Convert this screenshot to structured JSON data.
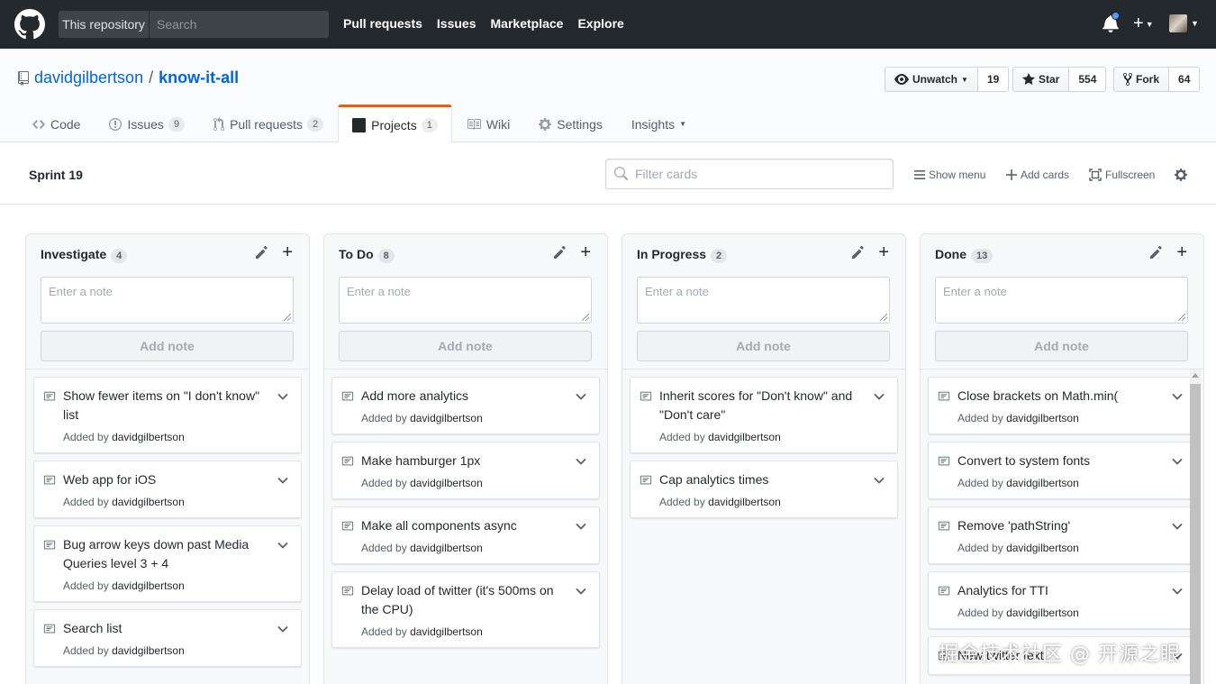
{
  "topbar": {
    "scope_label": "This repository",
    "search_placeholder": "Search",
    "nav": [
      "Pull requests",
      "Issues",
      "Marketplace",
      "Explore"
    ],
    "plus_label": "+"
  },
  "repo": {
    "owner": "davidgilbertson",
    "separator": "/",
    "name": "know-it-all",
    "actions": {
      "watch_label": "Unwatch",
      "watch_count": "19",
      "star_label": "Star",
      "star_count": "554",
      "fork_label": "Fork",
      "fork_count": "64"
    },
    "nav": [
      {
        "label": "Code",
        "count": ""
      },
      {
        "label": "Issues",
        "count": "9"
      },
      {
        "label": "Pull requests",
        "count": "2"
      },
      {
        "label": "Projects",
        "count": "1"
      },
      {
        "label": "Wiki",
        "count": ""
      },
      {
        "label": "Settings",
        "count": ""
      },
      {
        "label": "Insights",
        "count": ""
      }
    ]
  },
  "project": {
    "title": "Sprint 19",
    "filter_placeholder": "Filter cards",
    "show_menu": "Show menu",
    "add_cards": "Add cards",
    "fullscreen": "Fullscreen"
  },
  "note_form": {
    "placeholder": "Enter a note",
    "button": "Add note"
  },
  "meta_prefix": "Added by",
  "columns": [
    {
      "name": "Investigate",
      "count": "4",
      "cards": [
        {
          "title": "Show fewer items on \"I don't know\" list",
          "author": "davidgilbertson"
        },
        {
          "title": "Web app for iOS",
          "author": "davidgilbertson"
        },
        {
          "title": "Bug arrow keys down past Media Queries level 3 + 4",
          "author": "davidgilbertson"
        },
        {
          "title": "Search list",
          "author": "davidgilbertson"
        }
      ]
    },
    {
      "name": "To Do",
      "count": "8",
      "cards": [
        {
          "title": "Add more analytics",
          "author": "davidgilbertson"
        },
        {
          "title": "Make hamburger 1px",
          "author": "davidgilbertson"
        },
        {
          "title": "Make all components async",
          "author": "davidgilbertson"
        },
        {
          "title": "Delay load of twitter (it's 500ms on the CPU)",
          "author": "davidgilbertson"
        }
      ]
    },
    {
      "name": "In Progress",
      "count": "2",
      "cards": [
        {
          "title": "Inherit scores for \"Don't know\" and \"Don't care\"",
          "author": "davidgilbertson"
        },
        {
          "title": "Cap analytics times",
          "author": "davidgilbertson"
        }
      ]
    },
    {
      "name": "Done",
      "count": "13",
      "cards": [
        {
          "title": "Close brackets on Math.min(",
          "author": "davidgilbertson"
        },
        {
          "title": "Convert to system fonts",
          "author": "davidgilbertson"
        },
        {
          "title": "Remove 'pathString'",
          "author": "davidgilbertson"
        },
        {
          "title": "Analytics for TTI",
          "author": "davidgilbertson"
        },
        {
          "title": "New twitter text",
          "author": ""
        }
      ]
    }
  ],
  "watermark": "掘金技术社区 @ 开源之眼"
}
